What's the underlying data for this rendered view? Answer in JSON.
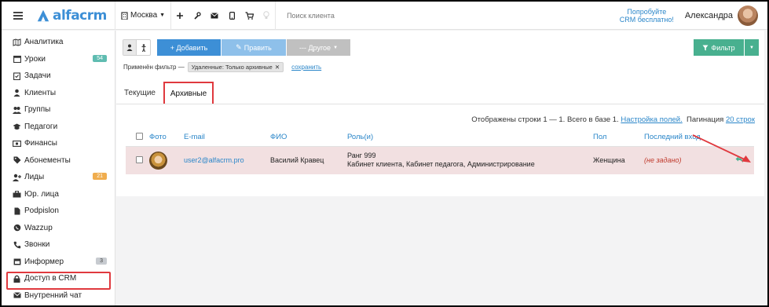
{
  "topbar": {
    "logo_text": "alfacrm",
    "branch": "Москва",
    "search_placeholder": "Поиск клиента",
    "try_line1": "Попробуйте",
    "try_line2": "CRM бесплатно!",
    "user_name": "Александра"
  },
  "sidebar": {
    "items": [
      {
        "label": "Аналитика",
        "icon": "analytics-icon"
      },
      {
        "label": "Уроки",
        "icon": "calendar-icon",
        "badge": "54"
      },
      {
        "label": "Задачи",
        "icon": "tasks-icon"
      },
      {
        "label": "Клиенты",
        "icon": "user-icon"
      },
      {
        "label": "Группы",
        "icon": "group-icon"
      },
      {
        "label": "Педагоги",
        "icon": "graduation-cap-icon"
      },
      {
        "label": "Финансы",
        "icon": "money-icon"
      },
      {
        "label": "Абонементы",
        "icon": "tag-icon"
      },
      {
        "label": "Лиды",
        "icon": "add-user-icon",
        "badge": "21"
      },
      {
        "label": "Юр. лица",
        "icon": "briefcase-icon"
      },
      {
        "label": "Podpislon",
        "icon": "document-icon"
      },
      {
        "label": "Wazzup",
        "icon": "whatsapp-icon"
      },
      {
        "label": "Звонки",
        "icon": "phone-icon"
      },
      {
        "label": "Информер",
        "icon": "calendar-icon",
        "badge": "3"
      },
      {
        "label": "Доступ в CRM",
        "icon": "lock-icon"
      },
      {
        "label": "Внутренний чат",
        "icon": "envelope-icon"
      }
    ]
  },
  "toolbar": {
    "add_label": "+ Добавить",
    "edit_label": "Править",
    "other_label": "--- Другое",
    "filter_label": "Фильтр"
  },
  "filter": {
    "applied_label": "Применён фильтр —",
    "chip_text": "Удаленные: Только архивные",
    "save_label": "сохранить"
  },
  "tabs": {
    "current": "Текущие",
    "archived": "Архивные"
  },
  "info": {
    "shown": "Отображены строки 1 — 1. Всего в базе 1.",
    "fields_link": "Настройка полей.",
    "pagination_label": "Пагинация",
    "pagination_value": "20 строк"
  },
  "table": {
    "headers": {
      "photo": "Фото",
      "email": "E-mail",
      "fio": "ФИО",
      "roles": "Роль(и)",
      "gender": "Пол",
      "last_login": "Последний вход"
    },
    "rows": [
      {
        "email": "user2@alfacrm.pro",
        "fio": "Василий Кравец",
        "rank": "Ранг 999",
        "roles": "Кабинет клиента, Кабинет педагога, Администрирование",
        "gender": "Женщина",
        "last_login": "(не задано)"
      }
    ]
  },
  "colors": {
    "accent": "#3d8fd6",
    "filter_green": "#48b08f",
    "highlight_red": "#e0393e",
    "archived_row": "#f2e0e1"
  }
}
